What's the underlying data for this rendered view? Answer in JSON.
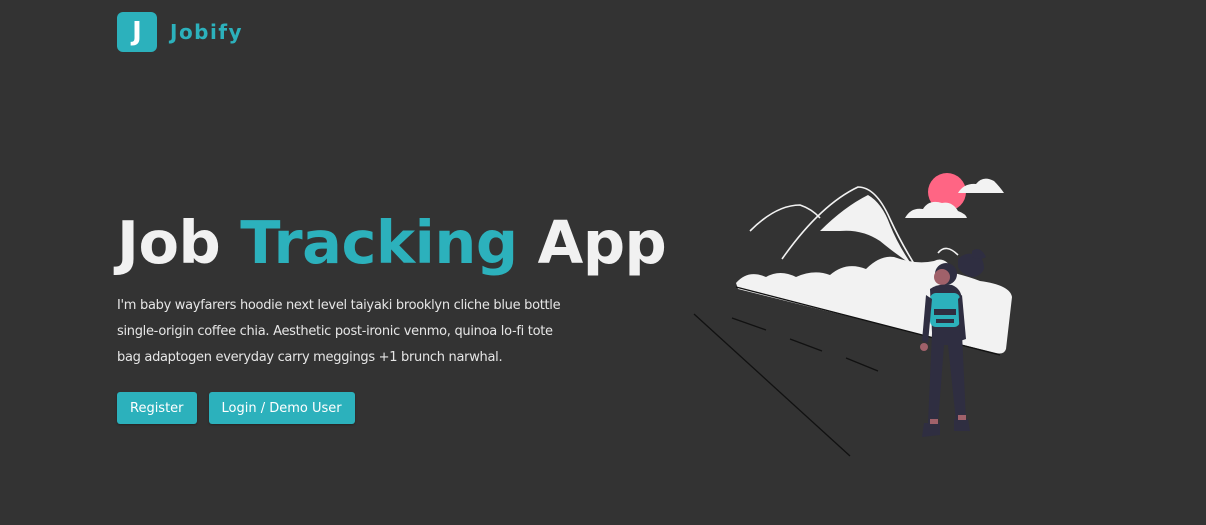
{
  "brand": {
    "logo_letter": "J",
    "name": "Jobify"
  },
  "hero": {
    "title_part1": "Job ",
    "title_accent": "Tracking",
    "title_part2": " App",
    "description": "I'm baby wayfarers hoodie next level taiyaki brooklyn cliche blue bottle single-origin coffee chia. Aesthetic post-ironic venmo, quinoa lo-fi tote bag adaptogen everyday carry meggings +1 brunch narwhal."
  },
  "buttons": {
    "register": "Register",
    "login": "Login / Demo User"
  },
  "colors": {
    "background": "#333333",
    "accent": "#2cb1bc",
    "sun": "#ff6584"
  },
  "illustration": "traveler-with-mountains"
}
